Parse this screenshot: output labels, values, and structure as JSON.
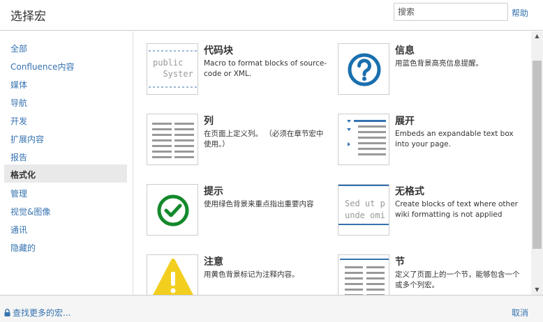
{
  "header": {
    "title": "选择宏",
    "search_placeholder": "搜索",
    "help_label": "帮助"
  },
  "sidebar": {
    "items": [
      {
        "label": "全部"
      },
      {
        "label": "Confluence内容"
      },
      {
        "label": "媒体"
      },
      {
        "label": "导航"
      },
      {
        "label": "开发"
      },
      {
        "label": "扩展内容"
      },
      {
        "label": "报告"
      },
      {
        "label": "格式化",
        "active": true
      },
      {
        "label": "管理"
      },
      {
        "label": "视觉&图像"
      },
      {
        "label": "通讯"
      },
      {
        "label": "隐藏的"
      }
    ]
  },
  "macros": [
    {
      "name": "代码块",
      "desc": "Macro to format blocks of source-code or XML.",
      "icon": "code-block-icon",
      "code_lines": [
        "public",
        "  Syster"
      ]
    },
    {
      "name": "信息",
      "desc": "用蓝色背景高亮信息提醒。",
      "icon": "info-question-icon"
    },
    {
      "name": "列",
      "desc": "在页面上定义列。 （必须在章节宏中使用。）",
      "icon": "column-icon"
    },
    {
      "name": "展开",
      "desc": "Embeds an expandable text box into your page.",
      "icon": "expand-icon"
    },
    {
      "name": "提示",
      "desc": "使用绿色背景来重点指出重要内容",
      "icon": "tip-check-icon"
    },
    {
      "name": "无格式",
      "desc": "Create blocks of text where other wiki formatting is not applied",
      "icon": "noformat-icon",
      "code_lines": [
        "Sed ut p",
        "unde omi"
      ]
    },
    {
      "name": "注意",
      "desc": "用黄色背景标记为注释内容。",
      "icon": "note-warning-icon"
    },
    {
      "name": "节",
      "desc": "定义了页面上的一个节，能够包含一个或多个列宏。",
      "icon": "section-icon"
    }
  ],
  "footer": {
    "find_more_label": "查找更多的宏...",
    "cancel_label": "取消"
  },
  "colors": {
    "link": "#3572b0",
    "info": "#1a6fae",
    "tip": "#14892c",
    "note": "#f2cf1f"
  }
}
